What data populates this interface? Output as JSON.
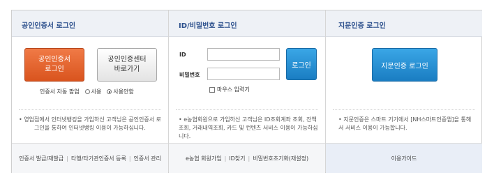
{
  "cert": {
    "title": "공인인증서 로그인",
    "login_btn_line1": "공인인증서",
    "login_btn_line2": "로그인",
    "center_btn_line1": "공인인증센터",
    "center_btn_line2": "바로가기",
    "auto_label": "인증서 자동 팝업",
    "opt_use": "사용",
    "opt_nouse": "사용안함",
    "selected": "사용안함",
    "note": "• 영업점에서 인터넷뱅킹을 가입하신 고객님은 공인인증서 로그인을 통하여 인터넷뱅킹 이용이 가능하십니다.",
    "links": [
      "인증서 발급/재발급",
      "타행/타기관인증서 등록",
      "인증서 관리"
    ]
  },
  "idpw": {
    "title": "ID/비밀번호 로그인",
    "id_label": "ID",
    "pw_label": "비밀번호",
    "login_btn": "로그인",
    "keyboard_label": "마우스 입력기",
    "note": "• e농협회원으로 가입하신 고객님은 ID조회계좌 조회, 잔액조회, 거래내역조회, 카드 및 컨텐츠 서비스 이용이 가능하십니다.",
    "links": [
      "e농협 회원가입",
      "ID찾기",
      "비밀번호초기화(재설정)"
    ]
  },
  "finger": {
    "title": "지문인증 로그인",
    "login_btn": "지문인증 로그인",
    "note": "• 지문인증은 스마트 기기에서 [NH스마트인증앱]을 통해서 서비스 이용이 가능합니다.",
    "guide_link": "이용가이드"
  }
}
